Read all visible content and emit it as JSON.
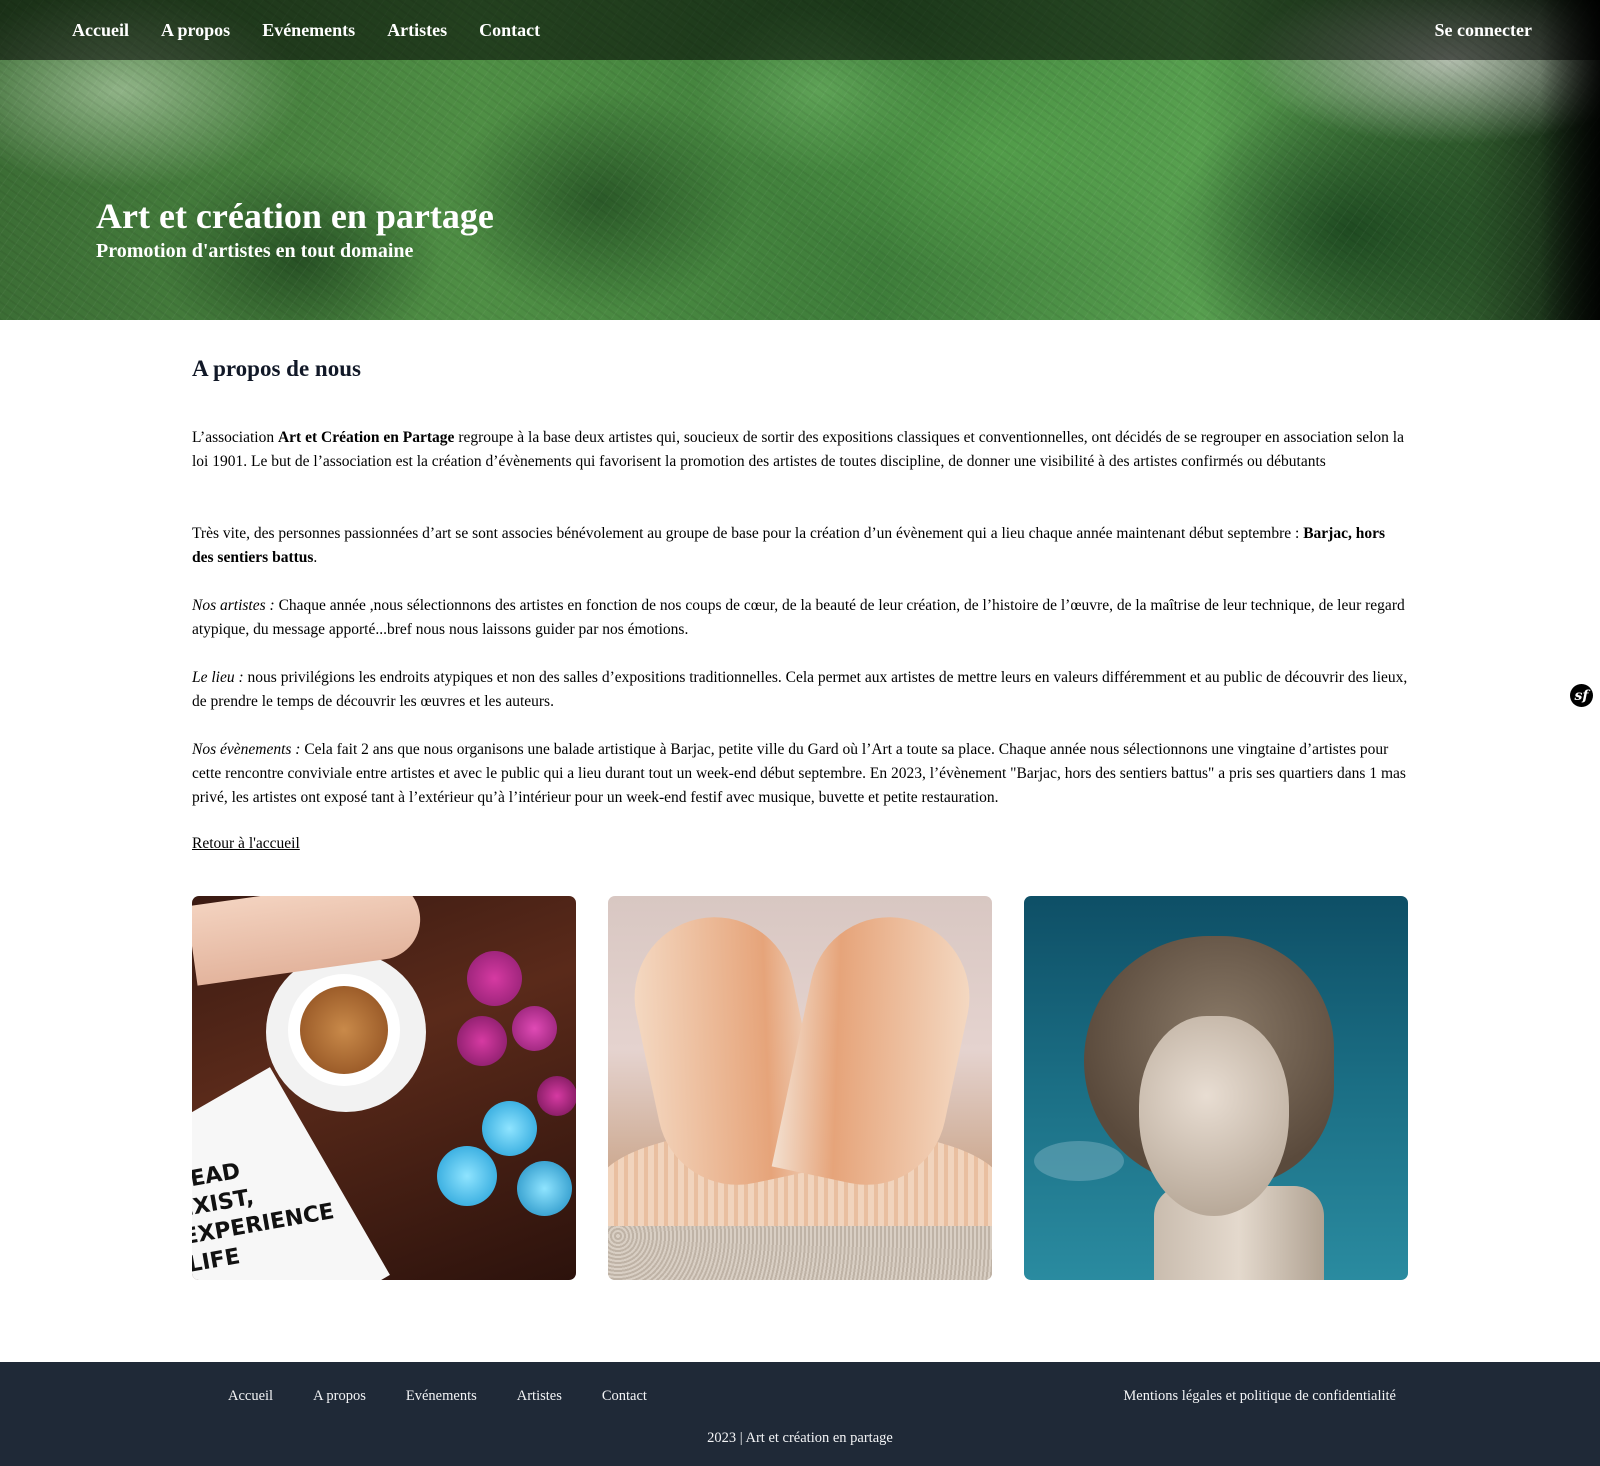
{
  "nav": {
    "items": [
      {
        "label": "Accueil"
      },
      {
        "label": "A propos"
      },
      {
        "label": "Evénements"
      },
      {
        "label": "Artistes"
      },
      {
        "label": "Contact"
      }
    ],
    "login_label": "Se connecter"
  },
  "hero": {
    "title": "Art et création en partage",
    "subtitle": "Promotion d'artistes en tout domaine"
  },
  "about": {
    "title": "A propos de nous",
    "p1_intro": "L’association ",
    "p1_strong": "Art et Création en Partage",
    "p1_rest": " regroupe à la base deux artistes qui, soucieux de sortir des expositions classiques et conventionnelles, ont décidés de se regrouper en association selon la loi 1901. Le but de l’association est la création d’évènements qui favorisent la promotion des artistes de toutes discipline, de donner une visibilité à des artistes confirmés ou débutants",
    "p2_text": "Très vite, des personnes passionnées d’art se sont associes bénévolement au groupe de base pour la création d’un évènement qui a lieu chaque année maintenant début septembre : ",
    "p2_strong": "Barjac, hors des sentiers battus",
    "p2_end": ".",
    "p3_label": "Nos artistes :",
    "p3_text": " Chaque année ,nous sélectionnons des artistes en fonction de nos coups de cœur, de la beauté de leur création, de l’histoire de l’œuvre, de la maîtrise de leur technique, de leur regard atypique, du message apporté...bref nous nous laissons guider par nos émotions.",
    "p4_label": "Le lieu :",
    "p4_text": " nous privilégions les endroits atypiques et non des salles d’expositions traditionnelles. Cela permet aux artistes de mettre leurs en valeurs différemment et au public de découvrir des lieux, de prendre le temps de découvrir les œuvres et les auteurs.",
    "p5_label": "Nos évènements :",
    "p5_text": " Cela fait 2 ans que nous organisons une balade artistique à Barjac, petite ville du Gard où l’Art a toute sa place. Chaque année nous sélectionnons une vingtaine d’artistes pour cette rencontre conviviale entre artistes et avec le public qui a lieu durant tout un week-end début septembre. En 2023, l’évènement \"Barjac, hors des sentiers battus\" a pris ses quartiers dans 1 mas privé, les artistes ont exposé tant à l’extérieur qu’à l’intérieur pour un week-end festif avec musique, buvette et petite restauration.",
    "back_link": "Retour à l'accueil"
  },
  "gallery": {
    "book_text": "READ EXIST, EXPERIENCE LIFE"
  },
  "footer": {
    "items": [
      {
        "label": "Accueil"
      },
      {
        "label": "A propos"
      },
      {
        "label": "Evénements"
      },
      {
        "label": "Artistes"
      },
      {
        "label": "Contact"
      }
    ],
    "legal": "Mentions légales et politique de confidentialité",
    "copyright": "2023 | Art et création en partage"
  },
  "badge": {
    "label": "sf"
  },
  "colors": {
    "footer_bg": "#1f2937",
    "title_color": "#111827"
  }
}
